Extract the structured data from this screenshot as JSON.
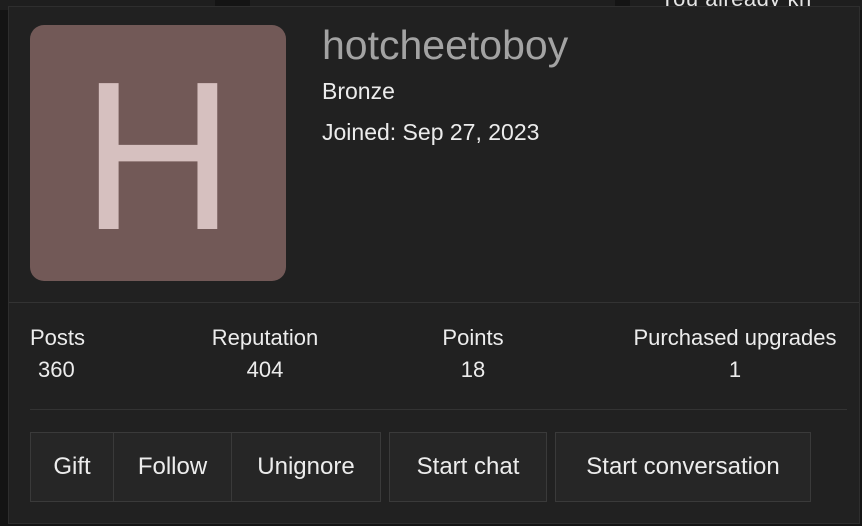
{
  "background": {
    "partial_text": "You already kn"
  },
  "profile": {
    "avatar_letter": "H",
    "avatar_color": "#725957",
    "username": "hotcheetoboy",
    "rank": "Bronze",
    "joined": "Joined: Sep 27, 2023"
  },
  "stats": [
    {
      "label": "Posts",
      "value": "360"
    },
    {
      "label": "Reputation",
      "value": "404"
    },
    {
      "label": "Points",
      "value": "18"
    },
    {
      "label": "Purchased upgrades",
      "value": "1"
    }
  ],
  "actions": {
    "gift": "Gift",
    "follow": "Follow",
    "unignore": "Unignore",
    "start_chat": "Start chat",
    "start_conversation": "Start conversation"
  }
}
